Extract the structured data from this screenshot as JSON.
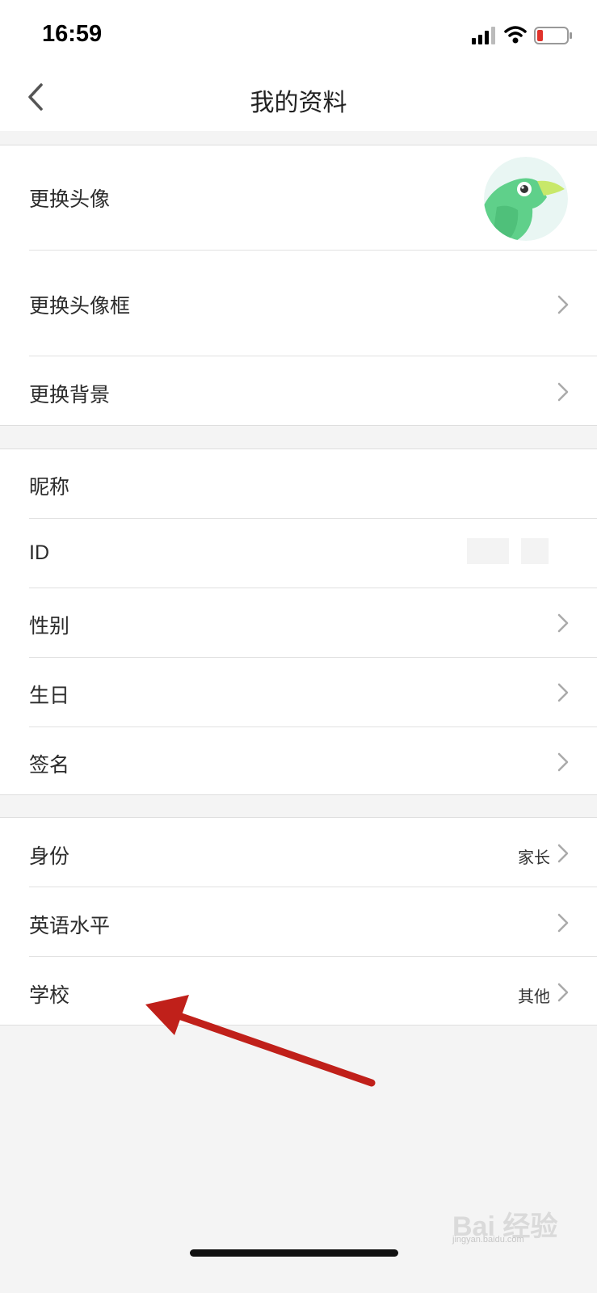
{
  "status": {
    "time": "16:59"
  },
  "nav": {
    "title": "我的资料"
  },
  "group1": {
    "change_avatar": "更换头像",
    "change_avatar_frame": "更换头像框",
    "change_background": "更换背景"
  },
  "group2": {
    "nickname": "昵称",
    "id": "ID",
    "gender": "性别",
    "birthday": "生日",
    "signature": "签名"
  },
  "group3": {
    "identity": "身份",
    "identity_value": "家长",
    "english_level": "英语水平",
    "school": "学校",
    "school_value": "其他"
  },
  "watermark": {
    "text": "Bai 经验",
    "sub": "jingyan.baidu.com"
  },
  "colors": {
    "arrow": "#c0201a",
    "avatar_green": "#5fd08a",
    "battery_low": "#e0322b"
  }
}
